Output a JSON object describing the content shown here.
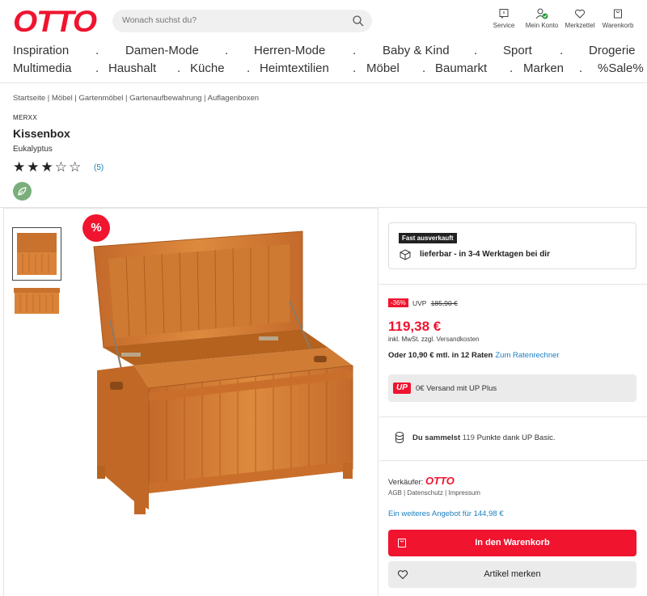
{
  "header": {
    "logo": "OTTO",
    "search_placeholder": "Wonach suchst du?",
    "icons": [
      {
        "label": "Service"
      },
      {
        "label": "Mein Konto"
      },
      {
        "label": "Merkzettel"
      },
      {
        "label": "Warenkorb"
      }
    ]
  },
  "nav": {
    "row1": [
      "Inspiration",
      ".",
      "Damen-Mode",
      ".",
      "Herren-Mode",
      ".",
      "Baby & Kind",
      ".",
      "Sport",
      ".",
      "Drogerie"
    ],
    "row2": [
      "Multimedia",
      ".",
      "Haushalt",
      ".",
      "Küche",
      ".",
      "Heimtextilien",
      ".",
      "Möbel",
      ".",
      "Baumarkt",
      ".",
      "Marken",
      ".",
      "%Sale%"
    ]
  },
  "breadcrumb": "Startseite | Möbel | Gartenmöbel | Gartenaufbewahrung | Auflagenboxen",
  "product": {
    "brand": "MERXX",
    "title": "Kissenbox",
    "variant": "Eukalyptus",
    "rating": {
      "value": 3,
      "max": 5,
      "stars_text": "★★★☆☆",
      "count": "(5)"
    }
  },
  "gallery": {
    "sale_badge": "%"
  },
  "availability": {
    "badge": "Fast ausverkauft",
    "delivery": "lieferbar - in 3-4 Werktagen bei dir"
  },
  "pricing": {
    "discount": "-36%",
    "uvp_label": "UVP",
    "uvp_price": "185,90 €",
    "price": "119,38 €",
    "vat_note": "inkl. MwSt. zzgl.",
    "shipping_link": "Versandkosten",
    "installment": "Oder 10,90 € mtl. in 12 Raten",
    "installment_link": "Zum Ratenrechner"
  },
  "up_plus": {
    "logo": "UP",
    "text": "0€ Versand mit UP Plus"
  },
  "points": {
    "prefix": "Du sammelst",
    "number": "119",
    "suffix": "Punkte dank UP Basic."
  },
  "seller": {
    "label": "Verkäufer:",
    "name": "OTTO",
    "legal": "AGB | Datenschutz | Impressum",
    "other_offer": "Ein weiteres Angebot für 144,98 €"
  },
  "actions": {
    "cart": "In den Warenkorb",
    "remember": "Artikel merken"
  },
  "colors": {
    "accent": "#f0142f",
    "link": "#1a7fc0"
  }
}
